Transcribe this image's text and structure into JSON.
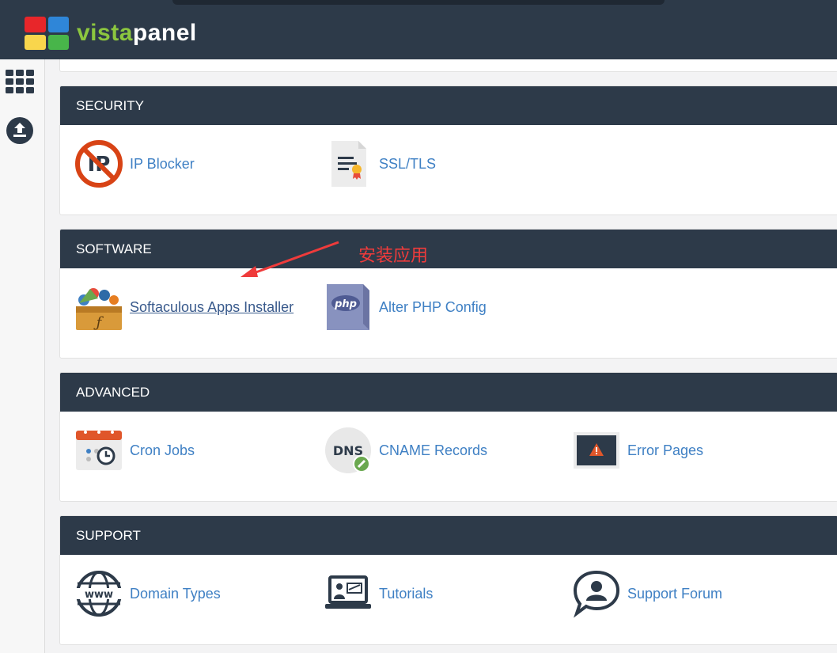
{
  "app": {
    "logo_part1": "vista",
    "logo_part2": "panel",
    "logo_colors": [
      "#e8262a",
      "#2f86d8",
      "#f9d64c",
      "#48b54a"
    ]
  },
  "sidebar": {
    "items": [
      {
        "icon": "grid-icon"
      },
      {
        "icon": "upload-icon"
      }
    ]
  },
  "sections": [
    {
      "title": "SECURITY",
      "items": [
        {
          "label": "IP Blocker",
          "icon": "ip-blocker-icon"
        },
        {
          "label": "SSL/TLS",
          "icon": "certificate-icon"
        }
      ]
    },
    {
      "title": "SOFTWARE",
      "items": [
        {
          "label": "Softaculous Apps Installer",
          "icon": "softaculous-icon"
        },
        {
          "label": "Alter PHP Config",
          "icon": "php-icon"
        }
      ]
    },
    {
      "title": "ADVANCED",
      "items": [
        {
          "label": "Cron Jobs",
          "icon": "calendar-clock-icon"
        },
        {
          "label": "CNAME Records",
          "icon": "dns-icon"
        },
        {
          "label": "Error Pages",
          "icon": "warning-screen-icon"
        }
      ]
    },
    {
      "title": "SUPPORT",
      "items": [
        {
          "label": "Domain Types",
          "icon": "www-globe-icon"
        },
        {
          "label": "Tutorials",
          "icon": "presentation-laptop-icon"
        },
        {
          "label": "Support Forum",
          "icon": "chat-user-icon"
        }
      ]
    }
  ],
  "annotation": {
    "text": "安装应用",
    "color": "#ef3b3b"
  },
  "colors": {
    "header_bg": "#2d3a49",
    "link": "#3f80c4",
    "page_bg": "#f3f3f4"
  }
}
